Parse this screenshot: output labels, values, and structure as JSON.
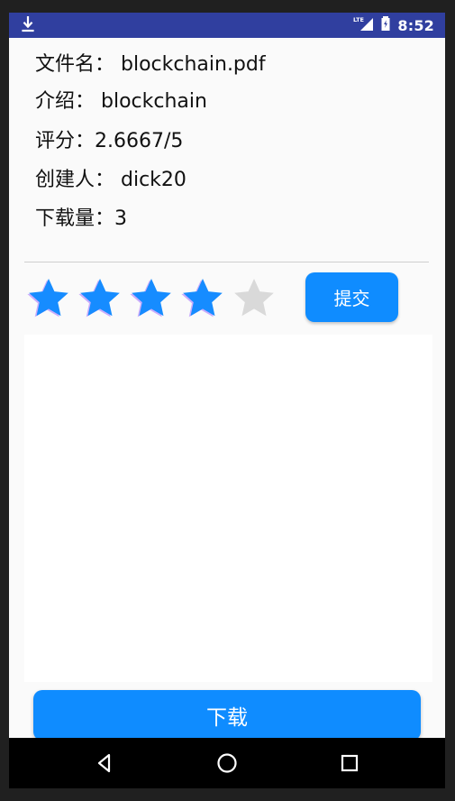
{
  "status": {
    "time": "8:52",
    "network": "LTE",
    "download_icon": "download-icon",
    "signal_icon": "signal-icon",
    "battery_icon": "battery-icon"
  },
  "file": {
    "name_line": "文件名： blockchain.pdf",
    "intro_line": "介绍： blockchain",
    "rating_line": "评分：2.6667/5",
    "creator_line": "创建人： dick20",
    "downloads_line": "下载量：3"
  },
  "rating": {
    "selected_stars": 4,
    "max_stars": 5,
    "submit_label": "提交"
  },
  "actions": {
    "download_label": "下载"
  },
  "colors": {
    "status_bar": "#303f9f",
    "accent_blue": "#0f8cff",
    "star_active": "#168cff",
    "star_inactive": "#d9d9d9"
  },
  "navigation": {
    "back_icon": "back-icon",
    "home_icon": "home-icon",
    "recents_icon": "recents-icon"
  }
}
